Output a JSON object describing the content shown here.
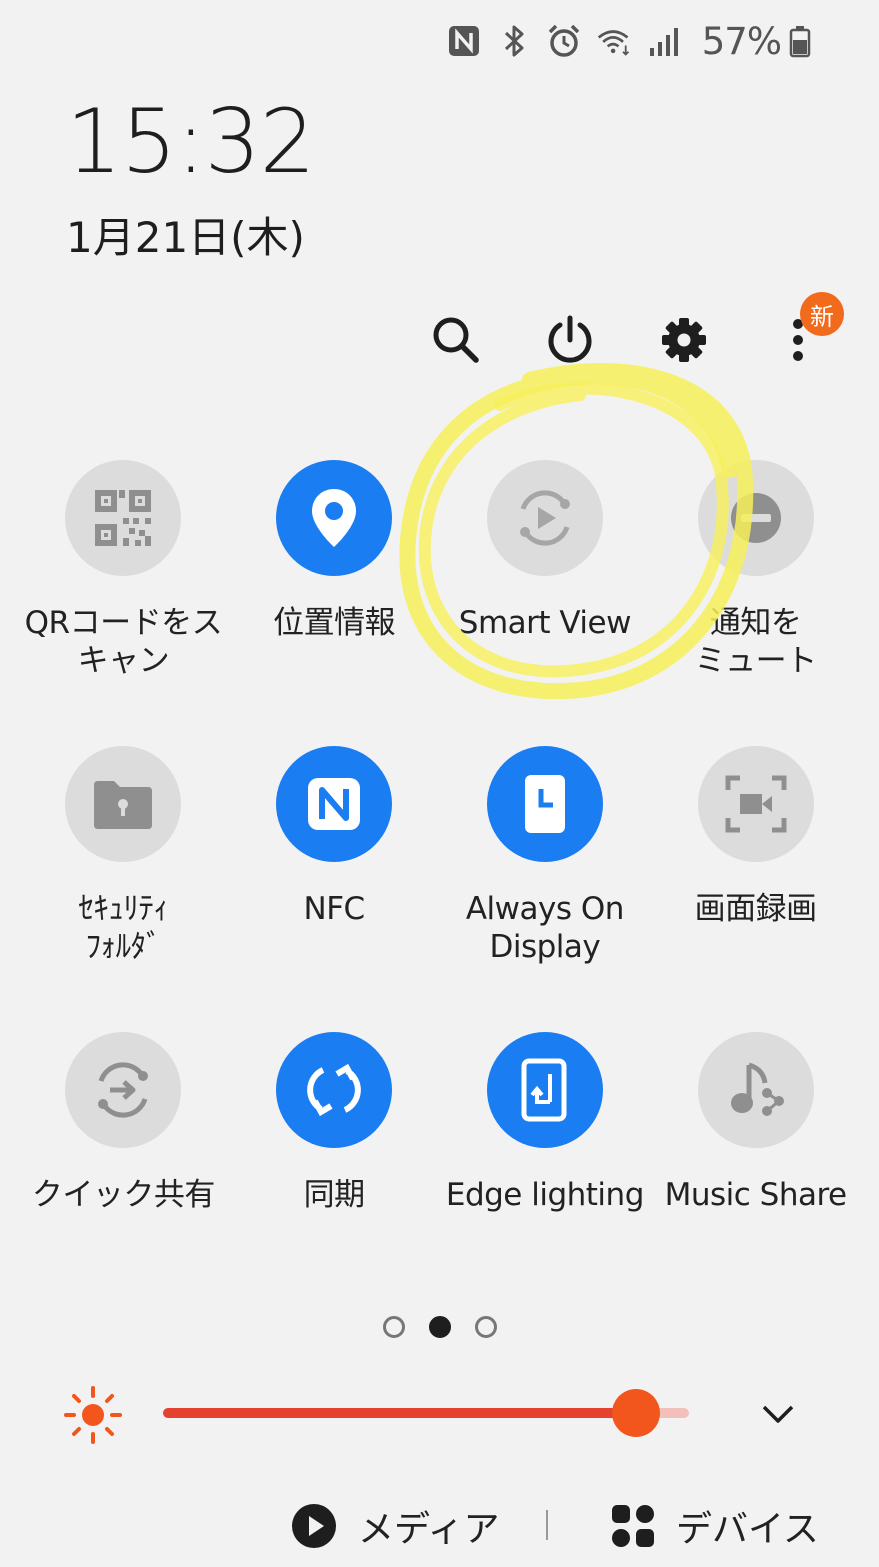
{
  "status_bar": {
    "icons": [
      "nfc-icon",
      "bluetooth-icon",
      "alarm-icon",
      "wifi-icon",
      "signal-icon",
      "battery-icon"
    ],
    "battery_percent": "57%"
  },
  "clock": {
    "time": "15:32",
    "date": "1月21日(木)"
  },
  "actions": {
    "icons": [
      "search-icon",
      "power-icon",
      "settings-icon",
      "more-icon"
    ],
    "new_badge": "新"
  },
  "tiles": [
    {
      "label": "QRコードをス\nキャン",
      "icon": "qr-code-icon",
      "on": false
    },
    {
      "label": "位置情報",
      "icon": "location-icon",
      "on": true
    },
    {
      "label": "Smart View",
      "icon": "smart-view-icon",
      "on": false
    },
    {
      "label": "通知を\nミュート",
      "icon": "mute-icon",
      "on": false
    },
    {
      "label": "ｾｷｭﾘﾃｨ\nﾌｫﾙﾀﾞ",
      "icon": "secure-folder-icon",
      "on": false
    },
    {
      "label": "NFC",
      "icon": "nfc-icon",
      "on": true
    },
    {
      "label": "Always On\nDisplay",
      "icon": "always-on-display-icon",
      "on": true
    },
    {
      "label": "画面録画",
      "icon": "screen-record-icon",
      "on": false
    },
    {
      "label": "クイック共有",
      "icon": "quick-share-icon",
      "on": false
    },
    {
      "label": "同期",
      "icon": "sync-icon",
      "on": true
    },
    {
      "label": "Edge lighting",
      "icon": "edge-lighting-icon",
      "on": true
    },
    {
      "label": "Music Share",
      "icon": "music-share-icon",
      "on": false
    }
  ],
  "pager": {
    "pages": 3,
    "current": 2
  },
  "brightness": {
    "level": 0.9,
    "accent": "#e5412f"
  },
  "bottom": {
    "media_label": "メディア",
    "devices_label": "デバイス"
  },
  "colors": {
    "tile_on": "#1a7ef2",
    "tile_off": "#dcdcdc",
    "highlight": "#f7f05a"
  }
}
